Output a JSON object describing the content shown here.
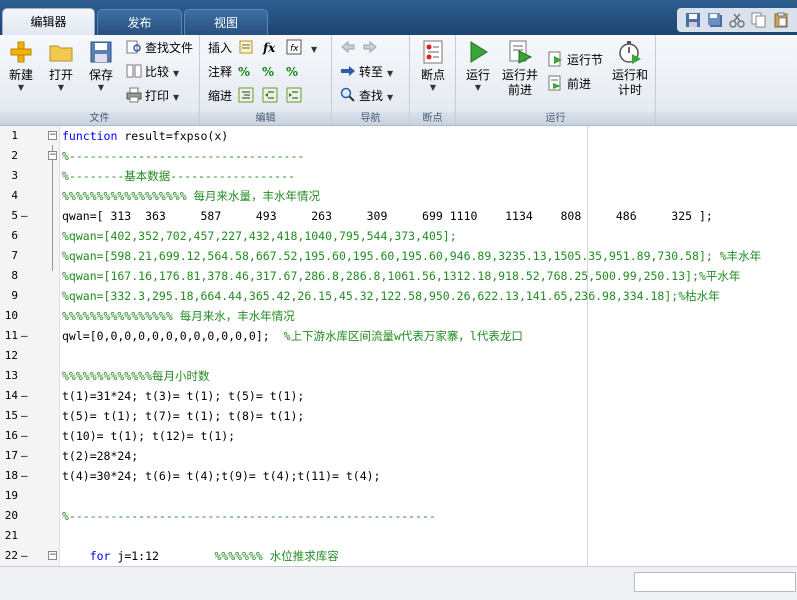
{
  "tabs": [
    {
      "label": "编辑器",
      "active": true
    },
    {
      "label": "发布",
      "active": false
    },
    {
      "label": "视图",
      "active": false
    }
  ],
  "ribbon": {
    "file": {
      "group_label": "文件",
      "new_label": "新建",
      "open_label": "打开",
      "save_label": "保存",
      "find_files_label": "查找文件",
      "compare_label": "比较",
      "print_label": "打印"
    },
    "edit": {
      "group_label": "编辑",
      "insert_label": "插入",
      "comment_label": "注释",
      "indent_label": "缩进",
      "fx_label": "fx"
    },
    "navigate": {
      "group_label": "导航",
      "goto_label": "转至",
      "find_label": "查找"
    },
    "breakpoints": {
      "group_label": "断点",
      "breakpoints_label": "断点"
    },
    "run": {
      "group_label": "运行",
      "run_label": "运行",
      "run_advance_label_1": "运行并",
      "run_advance_label_2": "前进",
      "run_section_label": "运行节",
      "advance_label": "前进",
      "run_time_label_1": "运行和",
      "run_time_label_2": "计时"
    }
  },
  "editor": {
    "lines": [
      {
        "num": "1",
        "dash": "",
        "fold": "minus",
        "segments": [
          {
            "t": "function",
            "c": "kw"
          },
          {
            "t": " result=fxpso(x)",
            "c": ""
          }
        ]
      },
      {
        "num": "2",
        "dash": "",
        "fold": "minus",
        "segments": [
          {
            "t": "%----------------------------------",
            "c": "cm"
          }
        ]
      },
      {
        "num": "3",
        "dash": "",
        "fold": "",
        "segments": [
          {
            "t": "%--------基本数据------------------",
            "c": "cm"
          }
        ]
      },
      {
        "num": "4",
        "dash": "",
        "fold": "",
        "segments": [
          {
            "t": "%%%%%%%%%%%%%%%%%% 每月来水量，丰水年情况",
            "c": "cm"
          }
        ]
      },
      {
        "num": "5",
        "dash": "–",
        "fold": "",
        "segments": [
          {
            "t": "qwan=[ 313  363     587     493     263     309     699 1110    1134    808     486     325 ];",
            "c": ""
          }
        ]
      },
      {
        "num": "6",
        "dash": "",
        "fold": "",
        "segments": [
          {
            "t": "%qwan=[402,352,702,457,227,432,418,1040,795,544,373,405];",
            "c": "cm"
          }
        ]
      },
      {
        "num": "7",
        "dash": "",
        "fold": "",
        "segments": [
          {
            "t": "%qwan=[598.21,699.12,564.58,667.52,195.60,195.60,195.60,946.89,3235.13,1505.35,951.89,730.58]; %丰水年",
            "c": "cm"
          }
        ]
      },
      {
        "num": "8",
        "dash": "",
        "fold": "",
        "segments": [
          {
            "t": "%qwan=[167.16,176.81,378.46,317.67,286.8,286.8,1061.56,1312.18,918.52,768.25,500.99,250.13];%平水年",
            "c": "cm"
          }
        ]
      },
      {
        "num": "9",
        "dash": "",
        "fold": "",
        "segments": [
          {
            "t": "%qwan=[332.3,295.18,664.44,365.42,26.15,45.32,122.58,950.26,622.13,141.65,236.98,334.18];%枯水年",
            "c": "cm"
          }
        ]
      },
      {
        "num": "10",
        "dash": "",
        "fold": "",
        "segments": [
          {
            "t": "%%%%%%%%%%%%%%%% 每月来水，丰水年情况",
            "c": "cm"
          }
        ]
      },
      {
        "num": "11",
        "dash": "–",
        "fold": "",
        "segments": [
          {
            "t": "qwl=[0,0,0,0,0,0,0,0,0,0,0,0];  ",
            "c": ""
          },
          {
            "t": "%上下游水库区间流量w代表万家寨，l代表龙口",
            "c": "cm"
          }
        ]
      },
      {
        "num": "12",
        "dash": "",
        "fold": "",
        "segments": []
      },
      {
        "num": "13",
        "dash": "",
        "fold": "",
        "segments": [
          {
            "t": "%%%%%%%%%%%%%每月小时数",
            "c": "cm"
          }
        ]
      },
      {
        "num": "14",
        "dash": "–",
        "fold": "",
        "segments": [
          {
            "t": "t(1)=31*24; t(3)= t(1); t(5)= t(1);",
            "c": ""
          }
        ]
      },
      {
        "num": "15",
        "dash": "–",
        "fold": "",
        "segments": [
          {
            "t": "t(5)= t(1); t(7)= t(1); t(8)= t(1);",
            "c": ""
          }
        ]
      },
      {
        "num": "16",
        "dash": "–",
        "fold": "",
        "segments": [
          {
            "t": "t(10)= t(1); t(12)= t(1);",
            "c": ""
          }
        ]
      },
      {
        "num": "17",
        "dash": "–",
        "fold": "",
        "segments": [
          {
            "t": "t(2)=28*24;",
            "c": ""
          }
        ]
      },
      {
        "num": "18",
        "dash": "–",
        "fold": "",
        "segments": [
          {
            "t": "t(4)=30*24; t(6)= t(4);t(9)= t(4);t(11)= t(4);",
            "c": ""
          }
        ]
      },
      {
        "num": "19",
        "dash": "",
        "fold": "",
        "segments": []
      },
      {
        "num": "20",
        "dash": "",
        "fold": "",
        "segments": [
          {
            "t": "%-----------------------------------------------------",
            "c": "cm"
          }
        ]
      },
      {
        "num": "21",
        "dash": "",
        "fold": "",
        "segments": []
      },
      {
        "num": "22",
        "dash": "–",
        "fold": "minus",
        "segments": [
          {
            "t": "    ",
            "c": ""
          },
          {
            "t": "for",
            "c": "kw"
          },
          {
            "t": " j=1:12        ",
            "c": ""
          },
          {
            "t": "%%%%%%% 水位推求库容",
            "c": "cm"
          }
        ]
      }
    ]
  },
  "colors": {
    "tabbar": "#1e4470",
    "keyword": "#0000ff",
    "comment": "#228b22"
  }
}
